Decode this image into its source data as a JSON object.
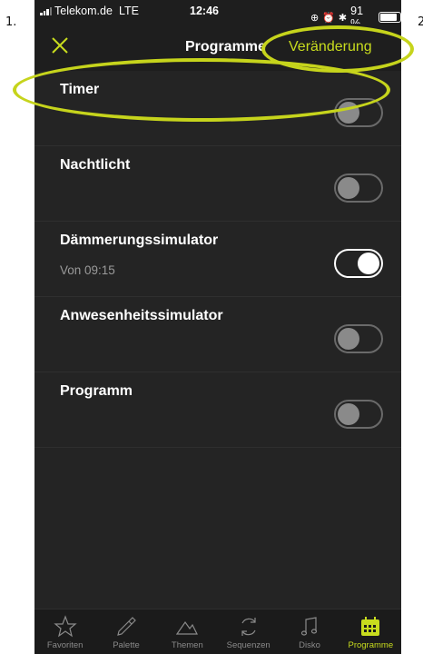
{
  "annotations": {
    "step1": "1.",
    "step2": "2."
  },
  "status_bar": {
    "carrier": "Telekom.de",
    "network": "LTE",
    "time": "12:46",
    "battery": "91 %",
    "battery_level": 0.91
  },
  "navbar": {
    "title": "Programme",
    "edit_label": "Veränderung",
    "close_icon": "close-icon"
  },
  "programs": [
    {
      "label": "Timer",
      "subtitle": "",
      "enabled": false
    },
    {
      "label": "Nachtlicht",
      "subtitle": "",
      "enabled": false
    },
    {
      "label": "Dämmerungssimulator",
      "subtitle": "Von 09:15",
      "enabled": true
    },
    {
      "label": "Anwesenheitssimulator",
      "subtitle": "",
      "enabled": false
    },
    {
      "label": "Programm",
      "subtitle": "",
      "enabled": false
    }
  ],
  "tabs": [
    {
      "label": "Favoriten",
      "icon": "star-icon",
      "active": false
    },
    {
      "label": "Palette",
      "icon": "eyedropper-icon",
      "active": false
    },
    {
      "label": "Themen",
      "icon": "mountain-icon",
      "active": false
    },
    {
      "label": "Sequenzen",
      "icon": "cycle-icon",
      "active": false
    },
    {
      "label": "Disko",
      "icon": "music-note-icon",
      "active": false
    },
    {
      "label": "Programme",
      "icon": "calendar-icon",
      "active": true
    }
  ],
  "colors": {
    "accent": "#c8dc1e",
    "background": "#242424",
    "annotation": "#c6d41c"
  }
}
